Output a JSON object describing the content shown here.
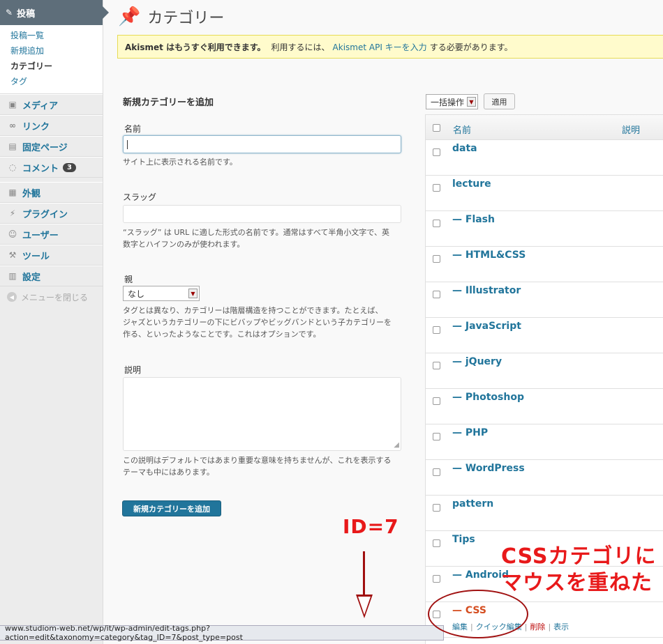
{
  "sidebar": {
    "active": {
      "label": "投稿",
      "icon": "pushpin-icon"
    },
    "submenu": [
      {
        "label": "投稿一覧",
        "current": false
      },
      {
        "label": "新規追加",
        "current": false
      },
      {
        "label": "カテゴリー",
        "current": true
      },
      {
        "label": "タグ",
        "current": false
      }
    ],
    "items": [
      {
        "label": "メディア",
        "icon": "media-icon"
      },
      {
        "label": "リンク",
        "icon": "link-icon"
      },
      {
        "label": "固定ページ",
        "icon": "pages-icon"
      },
      {
        "label": "コメント",
        "icon": "comments-icon",
        "badge": "3"
      },
      {
        "label": "外観",
        "icon": "appearance-icon"
      },
      {
        "label": "プラグイン",
        "icon": "plugins-icon"
      },
      {
        "label": "ユーザー",
        "icon": "users-icon"
      },
      {
        "label": "ツール",
        "icon": "tools-icon"
      },
      {
        "label": "設定",
        "icon": "settings-icon"
      }
    ],
    "collapse": "メニューを閉じる"
  },
  "header": {
    "title": "カテゴリー",
    "icon": "pushpin-icon"
  },
  "notice": {
    "strong": "Akismet はもうすぐ利用できます。",
    "text1": "利用するには、",
    "link": "Akismet API キーを入力",
    "text2": "する必要があります。"
  },
  "form": {
    "title": "新規カテゴリーを追加",
    "name_label": "名前",
    "name_value": "",
    "name_help": "サイト上に表示される名前です。",
    "slug_label": "スラッグ",
    "slug_value": "",
    "slug_help_1": "“スラッグ” は URL に適した形式の名前です。通常はすべて半角小文字で、英",
    "slug_help_2": "数字とハイフンのみが使われます。",
    "parent_label": "親",
    "parent_value": "なし",
    "parent_help_1": "タグとは異なり、カテゴリーは階層構造を持つことができます。たとえば、",
    "parent_help_2": "ジャズというカテゴリーの下にビバップやビッグバンドという子カテゴリーを",
    "parent_help_3": "作る、といったようなことです。これはオプションです。",
    "desc_label": "説明",
    "desc_value": "",
    "desc_help_1": "この説明はデフォルトではあまり重要な意味を持ちませんが、これを表示する",
    "desc_help_2": "テーマも中にはあります。",
    "submit": "新規カテゴリーを追加"
  },
  "list": {
    "bulk_action": "一括操作",
    "apply": "適用",
    "col_name": "名前",
    "col_desc": "説明",
    "rows": [
      {
        "name": "data"
      },
      {
        "name": "lecture"
      },
      {
        "name": "— Flash"
      },
      {
        "name": "— HTML&CSS"
      },
      {
        "name": "— Illustrator"
      },
      {
        "name": "— JavaScript"
      },
      {
        "name": "— jQuery"
      },
      {
        "name": "— Photoshop"
      },
      {
        "name": "— PHP"
      },
      {
        "name": "— WordPress"
      },
      {
        "name": "pattern"
      },
      {
        "name": "Tips"
      },
      {
        "name": "— Android"
      },
      {
        "name": "— CSS"
      }
    ],
    "row_actions": {
      "edit": "編集",
      "quick_edit": "クイック編集",
      "delete": "削除",
      "view": "表示",
      "sep": "|"
    }
  },
  "statusbar": {
    "url": "www.studiom-web.net/wp/it/wp-admin/edit-tags.php?action=edit&taxonomy=category&tag_ID=7&post_type=post"
  },
  "annotations": {
    "id_label": "ID=7",
    "note_line1": "CSSカテゴリに",
    "note_line2": "マウスを重ねた"
  },
  "colors": {
    "link": "#21759b",
    "hover": "#d54e21",
    "annotation": "#e8191a",
    "notice_bg": "#fffbcc"
  }
}
